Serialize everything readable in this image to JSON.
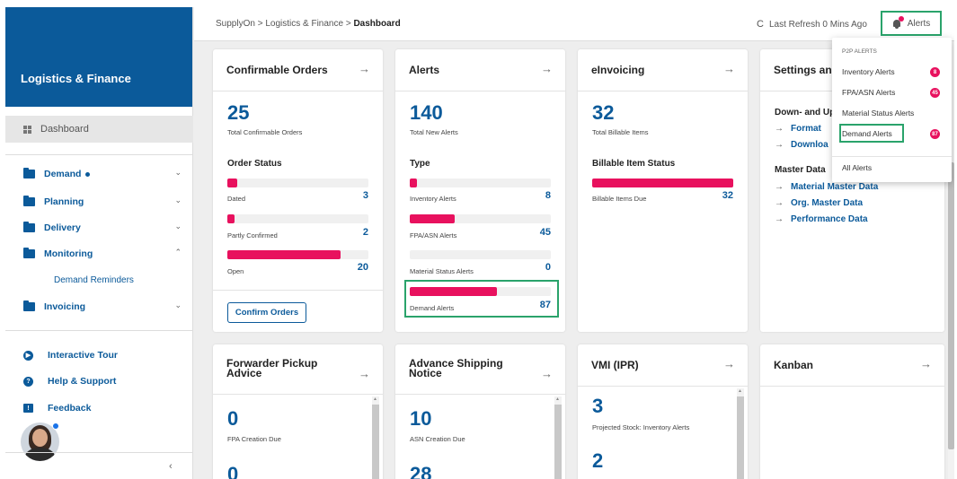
{
  "sidebar": {
    "app_title": "Logistics & Finance",
    "dashboard_label": "Dashboard",
    "nav": [
      {
        "label": "Demand",
        "chevron": "⌄"
      },
      {
        "label": "Planning",
        "chevron": "⌄"
      },
      {
        "label": "Delivery",
        "chevron": "⌄"
      },
      {
        "label": "Monitoring",
        "chevron": "⌃"
      },
      {
        "label": "Invoicing",
        "chevron": "⌄"
      }
    ],
    "sub_item": "Demand Reminders",
    "utilities": [
      {
        "label": "Interactive Tour",
        "icon": "play-icon",
        "glyph": "▶"
      },
      {
        "label": "Help & Support",
        "icon": "help-icon",
        "glyph": "?"
      },
      {
        "label": "Feedback",
        "icon": "feedback-icon",
        "glyph": "!"
      }
    ],
    "collapse_glyph": "‹"
  },
  "topbar": {
    "breadcrumb": {
      "root": "SupplyOn",
      "sep": " > ",
      "middle": "Logistics & Finance",
      "current": "Dashboard"
    },
    "refresh_glyph": "C",
    "refresh_text": "Last Refresh 0 Mins Ago",
    "alerts_label": "Alerts"
  },
  "arrow_glyph": "→",
  "cards": {
    "confirmable": {
      "title": "Confirmable Orders",
      "count": "25",
      "count_label": "Total Confirmable Orders",
      "section": "Order Status",
      "rows": [
        {
          "label": "Dated",
          "value": "3",
          "fraction": 0.07
        },
        {
          "label": "Partly Confirmed",
          "value": "2",
          "fraction": 0.05
        },
        {
          "label": "Open",
          "value": "20",
          "fraction": 0.8
        }
      ],
      "button": "Confirm Orders"
    },
    "alerts": {
      "title": "Alerts",
      "count": "140",
      "count_label": "Total New Alerts",
      "section": "Type",
      "rows": [
        {
          "label": "Inventory Alerts",
          "value": "8",
          "fraction": 0.05
        },
        {
          "label": "FPA/ASN Alerts",
          "value": "45",
          "fraction": 0.32
        },
        {
          "label": "Material Status Alerts",
          "value": "0",
          "fraction": 0.0
        },
        {
          "label": "Demand Alerts",
          "value": "87",
          "fraction": 0.62
        }
      ]
    },
    "einvoicing": {
      "title": "eInvoicing",
      "count": "32",
      "count_label": "Total Billable Items",
      "section": "Billable Item Status",
      "rows": [
        {
          "label": "Billable Items Due",
          "value": "32",
          "fraction": 1.0
        }
      ]
    },
    "settings": {
      "title": "Settings and",
      "section1": "Down- and Up",
      "links1": [
        "Format",
        "Downloa"
      ],
      "section2": "Master Data",
      "links2": [
        "Material Master Data",
        "Org. Master Data",
        "Performance Data"
      ]
    },
    "forwarder": {
      "title_line1": "Forwarder Pickup",
      "title_line2": "Advice",
      "count": "0",
      "count_label": "FPA Creation Due",
      "count2": "0"
    },
    "asn": {
      "title_line1": "Advance Shipping",
      "title_line2": "Notice",
      "count": "10",
      "count_label": "ASN Creation Due",
      "count2": "28"
    },
    "vmi": {
      "title": "VMI (IPR)",
      "count": "3",
      "count_label": "Projected Stock: Inventory Alerts",
      "count2": "2"
    },
    "kanban": {
      "title": "Kanban"
    }
  },
  "dropdown": {
    "header": "P2P ALERTS",
    "items": [
      {
        "label": "Inventory Alerts",
        "badge": "8"
      },
      {
        "label": "FPA/ASN Alerts",
        "badge": "45"
      },
      {
        "label": "Material Status Alerts",
        "badge": ""
      },
      {
        "label": "Demand Alerts",
        "badge": "87"
      },
      {
        "label": "All Alerts",
        "badge": ""
      }
    ]
  },
  "colors": {
    "brand": "#0b5a9a",
    "accent": "#e8115e",
    "highlight": "#2aa36b"
  }
}
